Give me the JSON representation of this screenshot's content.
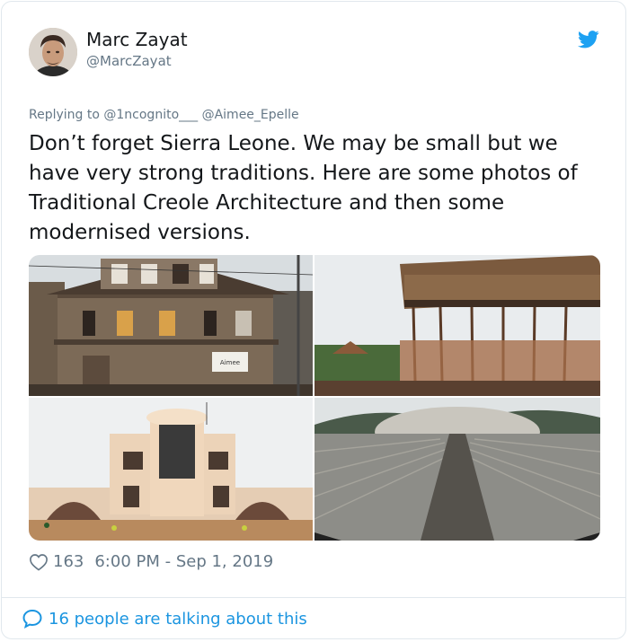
{
  "user": {
    "name": "Marc Zayat",
    "handle": "@MarcZayat"
  },
  "reply": {
    "prefix": "Replying to",
    "mention1": "@1ncognito___",
    "mention2": "@Aimee_Epelle"
  },
  "tweet": {
    "text": "Don’t forget Sierra Leone. We may be small but we have very strong traditions. Here are some photos of Traditional Creole Architecture and then some modernised versions."
  },
  "media": {
    "photos": [
      {
        "subject": "wooden-creole-house",
        "sign": "Aimee"
      },
      {
        "subject": "house-on-stilts"
      },
      {
        "subject": "modern-villa"
      },
      {
        "subject": "dome-roof"
      }
    ]
  },
  "stats": {
    "likes": "163",
    "timestamp": "6:00 PM - Sep 1, 2019"
  },
  "footer": {
    "talking": "16 people are talking about this"
  },
  "icons": {
    "bird": "twitter-bird-icon",
    "heart": "heart-icon",
    "reply": "comment-bubble-icon"
  },
  "colors": {
    "text": "#14171a",
    "secondary": "#657786",
    "accent": "#1da1f2",
    "link": "#1b95e0",
    "border": "#e1e8ed"
  }
}
